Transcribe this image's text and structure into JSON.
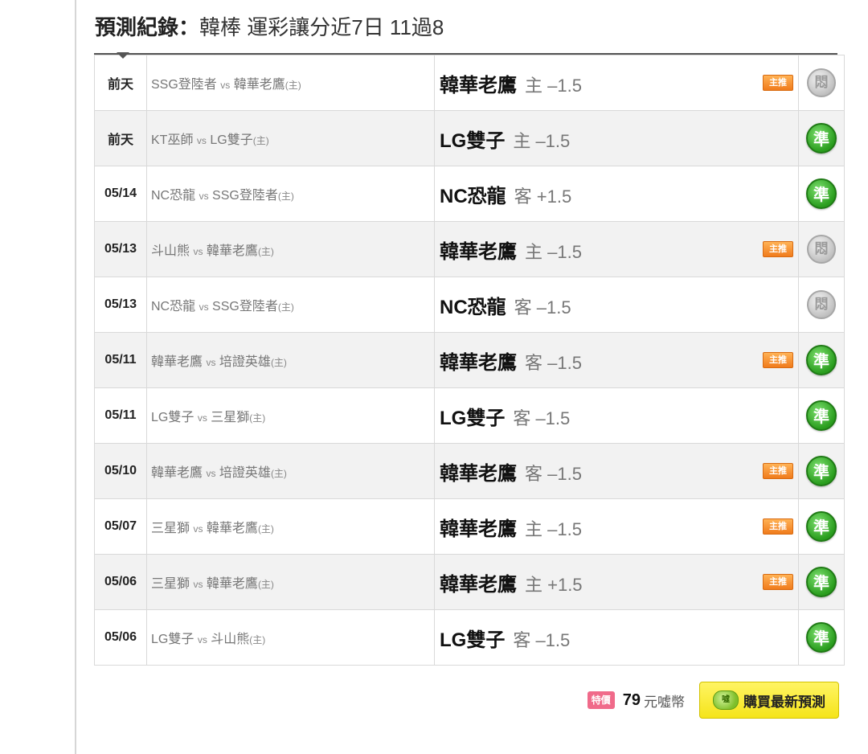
{
  "heading": {
    "prefix": "預測紀錄：",
    "subject": "韓棒 運彩讓分近7日 11過8"
  },
  "badges": {
    "main_pick": "主推",
    "win_icon": "準",
    "push_icon": "悶",
    "home_marker": "(主)"
  },
  "vs_label": "vs",
  "rows": [
    {
      "date": "前天",
      "away": "SSG登陸者",
      "home": "韓華老鷹",
      "pick_team": "韓華老鷹",
      "pick_line": "主 –1.5",
      "main": true,
      "result": "push"
    },
    {
      "date": "前天",
      "away": "KT巫師",
      "home": "LG雙子",
      "pick_team": "LG雙子",
      "pick_line": "主 –1.5",
      "main": false,
      "result": "win"
    },
    {
      "date": "05/14",
      "away": "NC恐龍",
      "home": "SSG登陸者",
      "pick_team": "NC恐龍",
      "pick_line": "客 +1.5",
      "main": false,
      "result": "win"
    },
    {
      "date": "05/13",
      "away": "斗山熊",
      "home": "韓華老鷹",
      "pick_team": "韓華老鷹",
      "pick_line": "主 –1.5",
      "main": true,
      "result": "push"
    },
    {
      "date": "05/13",
      "away": "NC恐龍",
      "home": "SSG登陸者",
      "pick_team": "NC恐龍",
      "pick_line": "客 –1.5",
      "main": false,
      "result": "push"
    },
    {
      "date": "05/11",
      "away": "韓華老鷹",
      "home": "培證英雄",
      "pick_team": "韓華老鷹",
      "pick_line": "客 –1.5",
      "main": true,
      "result": "win"
    },
    {
      "date": "05/11",
      "away": "LG雙子",
      "home": "三星獅",
      "pick_team": "LG雙子",
      "pick_line": "客 –1.5",
      "main": false,
      "result": "win"
    },
    {
      "date": "05/10",
      "away": "韓華老鷹",
      "home": "培證英雄",
      "pick_team": "韓華老鷹",
      "pick_line": "客 –1.5",
      "main": true,
      "result": "win"
    },
    {
      "date": "05/07",
      "away": "三星獅",
      "home": "韓華老鷹",
      "pick_team": "韓華老鷹",
      "pick_line": "主 –1.5",
      "main": true,
      "result": "win"
    },
    {
      "date": "05/06",
      "away": "三星獅",
      "home": "韓華老鷹",
      "pick_team": "韓華老鷹",
      "pick_line": "主 +1.5",
      "main": true,
      "result": "win"
    },
    {
      "date": "05/06",
      "away": "LG雙子",
      "home": "斗山熊",
      "pick_team": "LG雙子",
      "pick_line": "客 –1.5",
      "main": false,
      "result": "win"
    }
  ],
  "footer": {
    "special_label": "特價",
    "price": "79",
    "currency": "元噓幣",
    "coin_label": "噓",
    "buy_label": "購買最新預測"
  }
}
